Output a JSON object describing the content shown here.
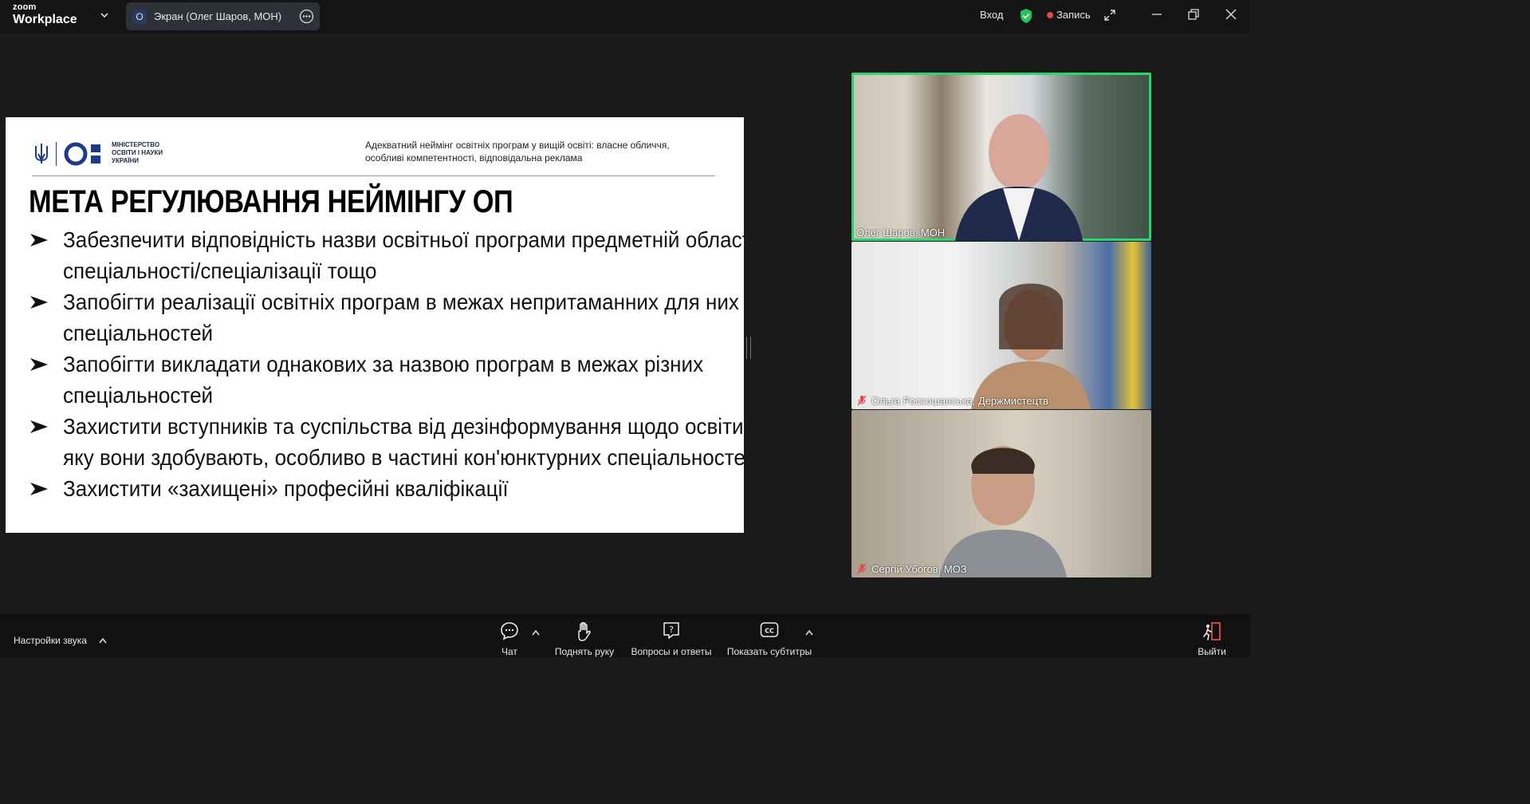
{
  "topbar": {
    "logo_small": "zoom",
    "logo_big": "Workplace",
    "share_badge": "O",
    "share_label": "Экран (Олег Шаров, МОН)",
    "signin_label": "Вход",
    "record_label": "Запись"
  },
  "slide": {
    "ministry_line1": "МІНІСТЕРСТВО",
    "ministry_line2": "ОСВІТИ І НАУКИ",
    "ministry_line3": "УКРАЇНИ",
    "header_line1": "Адекватний неймінг освітніх програм у вищій освіті: власне обличчя,",
    "header_line2": "особливі компетентності, відповідальна реклама",
    "title": "МЕТА РЕГУЛЮВАННЯ НЕЙМІНГУ ОП",
    "bullets": [
      "Забезпечити відповідність назви освітньої програми предметній області спеціальності/спеціалізації тощо",
      "Запобігти реалізації освітніх програм в межах непритаманних для них спеціальностей",
      "Запобігти викладати однакових за назвою програм в межах різних спеціальностей",
      "Захистити вступників та суспільства від дезінформування щодо освіти, яку вони здобувають, особливо в частині кон'юнктурних спеціальностей",
      "Захистити «захищені» професійні кваліфікації"
    ]
  },
  "participants": [
    {
      "name": "Олег Шаров, МОН",
      "muted": false,
      "active": true
    },
    {
      "name": "Ольга Россошанська, Держмистецтв",
      "muted": true,
      "active": false
    },
    {
      "name": "Сергій Убогов, МОЗ",
      "muted": true,
      "active": false
    }
  ],
  "bottombar": {
    "audio_settings_label": "Настройки звука",
    "chat_label": "Чат",
    "raise_hand_label": "Поднять руку",
    "qa_label": "Вопросы и ответы",
    "captions_label": "Показать субтитры",
    "leave_label": "Выйти"
  },
  "colors": {
    "active_speaker_border": "#2bd66e",
    "record_dot": "#e5484d",
    "leave_red": "#e5484d",
    "shield_green": "#22c55e"
  }
}
